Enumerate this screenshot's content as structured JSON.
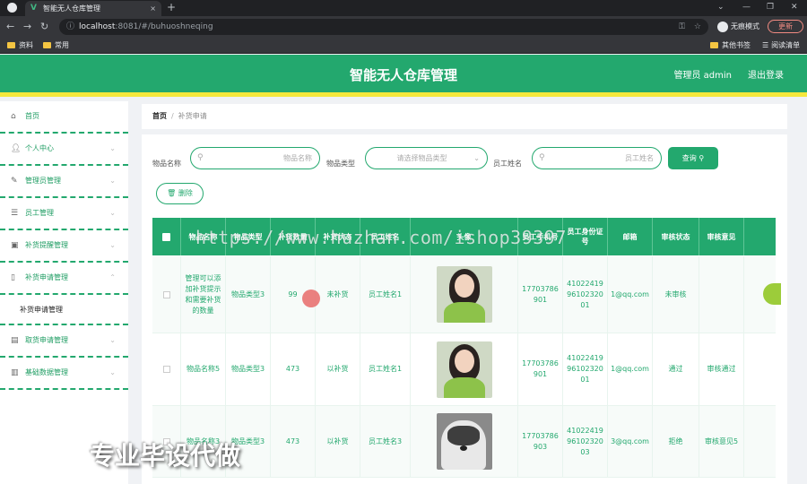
{
  "browser": {
    "tab_title": "智能无人仓库管理",
    "url_host": "localhost",
    "url_path": ":8081/#/buhuoshneqing",
    "incognito_label": "无痕模式",
    "update_label": "更新",
    "bookmarks": [
      {
        "label": "资料"
      },
      {
        "label": "常用"
      }
    ],
    "bookmarks_right": [
      {
        "label": "其他书签"
      },
      {
        "label": "阅读清单"
      }
    ]
  },
  "header": {
    "title": "智能无人仓库管理",
    "user": "管理员 admin",
    "logout": "退出登录"
  },
  "sidebar": {
    "items": [
      {
        "label": "首页",
        "icon": "home-icon"
      },
      {
        "label": "个人中心",
        "icon": "user-icon"
      },
      {
        "label": "管理员管理",
        "icon": "admin-icon"
      },
      {
        "label": "员工管理",
        "icon": "list-icon"
      },
      {
        "label": "补货提醒管理",
        "icon": "bell-icon"
      },
      {
        "label": "补货申请管理",
        "icon": "file-icon"
      },
      {
        "label": "取货申请管理",
        "icon": "box-icon"
      },
      {
        "label": "基础数据管理",
        "icon": "chart-icon"
      }
    ],
    "subitem": "补货申请管理"
  },
  "breadcrumb": {
    "home": "首页",
    "current": "补货申请"
  },
  "filters": {
    "name_label": "物品名称",
    "name_placeholder": "物品名称",
    "type_label": "物品类型",
    "type_placeholder": "请选择物品类型",
    "staff_label": "员工姓名",
    "staff_placeholder": "员工姓名",
    "query_label": "查询",
    "delete_label": "删除"
  },
  "table": {
    "headers": [
      "物品名称",
      "物品类型",
      "补货数量",
      "补货状态",
      "员工姓名",
      "头像",
      "员工手机号",
      "员工身份证号",
      "邮箱",
      "审核状态",
      "审核意见"
    ],
    "rows": [
      {
        "name": "管理可以添加补货提示和需要补货的数量",
        "type": "物品类型3",
        "qty": "99",
        "status": "未补货",
        "staff": "员工姓名1",
        "avatar": "girl",
        "phone": "17703786901",
        "idcard": "410224199610232001",
        "email": "1@qq.com",
        "audit": "未审核",
        "opinion": ""
      },
      {
        "name": "物品名称5",
        "type": "物品类型3",
        "qty": "473",
        "status": "以补货",
        "staff": "员工姓名1",
        "avatar": "girl",
        "phone": "17703786901",
        "idcard": "410224199610232001",
        "email": "1@qq.com",
        "audit": "通过",
        "opinion": "审核通过"
      },
      {
        "name": "物品名称3",
        "type": "物品类型3",
        "qty": "473",
        "status": "以补货",
        "staff": "员工姓名3",
        "avatar": "dog",
        "phone": "17703786903",
        "idcard": "410224199610232003",
        "email": "3@qq.com",
        "audit": "拒绝",
        "opinion": "审核意见5"
      }
    ]
  },
  "watermark": "https://www.huzhan.com/ishop39397",
  "overlay": "专业毕设代做",
  "colors": {
    "primary": "#23a86e",
    "accent_bar": "#f5e83c"
  }
}
